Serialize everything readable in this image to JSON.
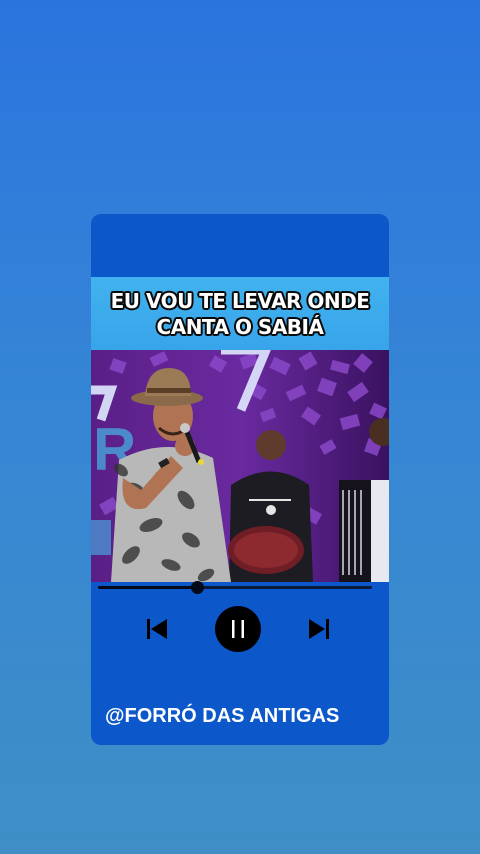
{
  "lyrics": {
    "line1": "EU VOU TE LEVAR ONDE",
    "line2": "CANTA O SABIÁ"
  },
  "video": {
    "description_icon": "video-frame-image"
  },
  "player": {
    "progress_fraction": 0.36,
    "controls": {
      "previous_icon": "skip-previous-icon",
      "pause_icon": "pause-icon",
      "next_icon": "skip-next-icon"
    }
  },
  "handle": "@FORRÓ DAS ANTIGAS",
  "colors": {
    "background_top": "#2a74de",
    "background_bottom": "#3f8fc6",
    "card": "#0c57c9",
    "banner": "#41b2ee",
    "button": "#000000",
    "text": "#ffffff"
  }
}
